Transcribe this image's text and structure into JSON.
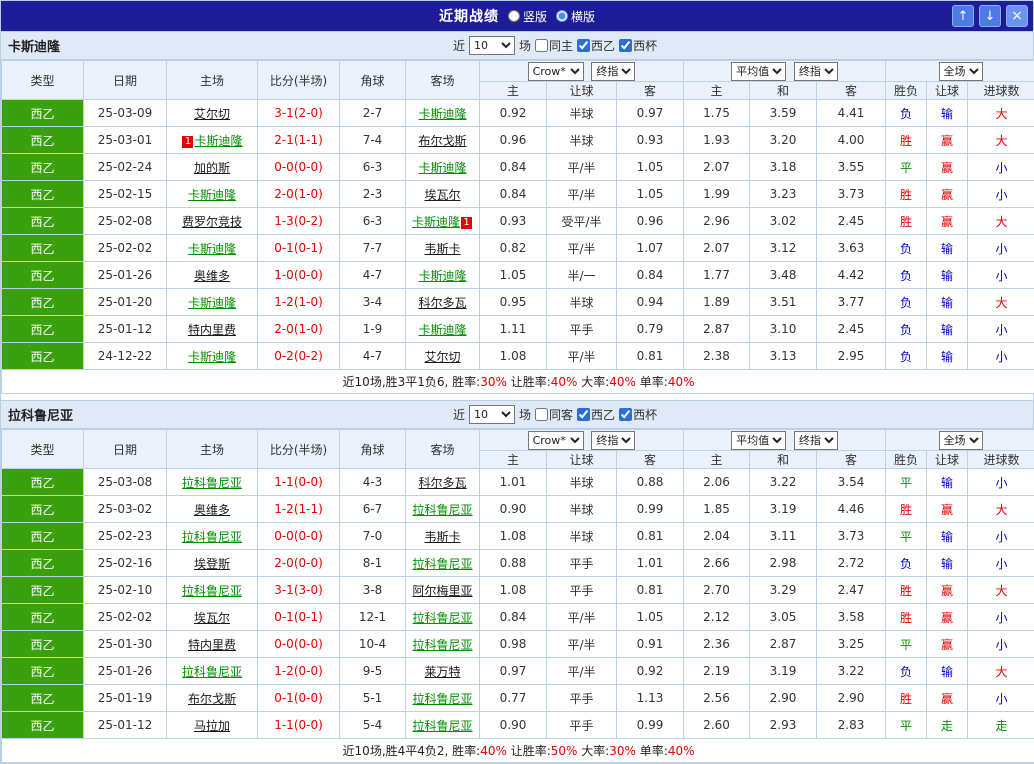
{
  "titlebar": {
    "title": "近期战绩",
    "radios": [
      {
        "label": "竖版",
        "selected": false
      },
      {
        "label": "横版",
        "selected": true
      }
    ],
    "up_button": "↑",
    "down_button": "↓",
    "close_button": "×"
  },
  "colors": {
    "titlebar_navy": "#1d1d99",
    "league_green": "#39a10c",
    "win_red": "#e60000",
    "loss_blue": "#0000cd",
    "draw_green": "#009100"
  },
  "columns": {
    "left": [
      "类型",
      "日期",
      "主场",
      "比分(半场)",
      "角球",
      "客场"
    ],
    "odds": [
      "主",
      "让球",
      "客"
    ],
    "avg": [
      "主",
      "和",
      "客"
    ],
    "result": [
      "胜负",
      "让球",
      "进球数"
    ]
  },
  "dropdowns": {
    "company": "Crow*",
    "final_index": "终指",
    "average": "平均值",
    "full_match": "全场"
  },
  "filter_labels": {
    "near": "近",
    "games": "场"
  },
  "sections": [
    {
      "team": "卡斯迪隆",
      "filter": {
        "count": "10",
        "same_venue": {
          "label": "同主",
          "checked": false
        },
        "league_a": {
          "label": "西乙",
          "checked": true
        },
        "league_b": {
          "label": "西杯",
          "checked": true
        }
      },
      "rows": [
        {
          "league": "西乙",
          "date": "25-03-09",
          "home": "艾尔切",
          "home_focus": false,
          "home_badge": "",
          "score": "3-1(2-0)",
          "corners": "2-7",
          "away": "卡斯迪隆",
          "away_focus": true,
          "away_badge": "",
          "odds": [
            "0.92",
            "半球",
            "0.97"
          ],
          "avg": [
            "1.75",
            "3.59",
            "4.41"
          ],
          "outcome": [
            "负",
            "输",
            "大"
          ]
        },
        {
          "league": "西乙",
          "date": "25-03-01",
          "home": "卡斯迪隆",
          "home_focus": true,
          "home_badge": "1",
          "score": "2-1(1-1)",
          "corners": "7-4",
          "away": "布尔戈斯",
          "away_focus": false,
          "away_badge": "",
          "odds": [
            "0.96",
            "半球",
            "0.93"
          ],
          "avg": [
            "1.93",
            "3.20",
            "4.00"
          ],
          "outcome": [
            "胜",
            "赢",
            "大"
          ]
        },
        {
          "league": "西乙",
          "date": "25-02-24",
          "home": "加的斯",
          "home_focus": false,
          "home_badge": "",
          "score": "0-0(0-0)",
          "corners": "6-3",
          "away": "卡斯迪隆",
          "away_focus": true,
          "away_badge": "",
          "odds": [
            "0.84",
            "平/半",
            "1.05"
          ],
          "avg": [
            "2.07",
            "3.18",
            "3.55"
          ],
          "outcome": [
            "平",
            "赢",
            "小"
          ]
        },
        {
          "league": "西乙",
          "date": "25-02-15",
          "home": "卡斯迪隆",
          "home_focus": true,
          "home_badge": "",
          "score": "2-0(1-0)",
          "corners": "2-3",
          "away": "埃瓦尔",
          "away_focus": false,
          "away_badge": "",
          "odds": [
            "0.84",
            "平/半",
            "1.05"
          ],
          "avg": [
            "1.99",
            "3.23",
            "3.73"
          ],
          "outcome": [
            "胜",
            "赢",
            "小"
          ]
        },
        {
          "league": "西乙",
          "date": "25-02-08",
          "home": "费罗尔竞技",
          "home_focus": false,
          "home_badge": "",
          "score": "1-3(0-2)",
          "corners": "6-3",
          "away": "卡斯迪隆",
          "away_focus": true,
          "away_badge": "1",
          "odds": [
            "0.93",
            "受平/半",
            "0.96"
          ],
          "avg": [
            "2.96",
            "3.02",
            "2.45"
          ],
          "outcome": [
            "胜",
            "赢",
            "大"
          ]
        },
        {
          "league": "西乙",
          "date": "25-02-02",
          "home": "卡斯迪隆",
          "home_focus": true,
          "home_badge": "",
          "score": "0-1(0-1)",
          "corners": "7-7",
          "away": "韦斯卡",
          "away_focus": false,
          "away_badge": "",
          "odds": [
            "0.82",
            "平/半",
            "1.07"
          ],
          "avg": [
            "2.07",
            "3.12",
            "3.63"
          ],
          "outcome": [
            "负",
            "输",
            "小"
          ]
        },
        {
          "league": "西乙",
          "date": "25-01-26",
          "home": "奥维多",
          "home_focus": false,
          "home_badge": "",
          "score": "1-0(0-0)",
          "corners": "4-7",
          "away": "卡斯迪隆",
          "away_focus": true,
          "away_badge": "",
          "odds": [
            "1.05",
            "半/一",
            "0.84"
          ],
          "avg": [
            "1.77",
            "3.48",
            "4.42"
          ],
          "outcome": [
            "负",
            "输",
            "小"
          ]
        },
        {
          "league": "西乙",
          "date": "25-01-20",
          "home": "卡斯迪隆",
          "home_focus": true,
          "home_badge": "",
          "score": "1-2(1-0)",
          "corners": "3-4",
          "away": "科尔多瓦",
          "away_focus": false,
          "away_badge": "",
          "odds": [
            "0.95",
            "半球",
            "0.94"
          ],
          "avg": [
            "1.89",
            "3.51",
            "3.77"
          ],
          "outcome": [
            "负",
            "输",
            "大"
          ]
        },
        {
          "league": "西乙",
          "date": "25-01-12",
          "home": "特内里费",
          "home_focus": false,
          "home_badge": "",
          "score": "2-0(1-0)",
          "corners": "1-9",
          "away": "卡斯迪隆",
          "away_focus": true,
          "away_badge": "",
          "odds": [
            "1.11",
            "平手",
            "0.79"
          ],
          "avg": [
            "2.87",
            "3.10",
            "2.45"
          ],
          "outcome": [
            "负",
            "输",
            "小"
          ]
        },
        {
          "league": "西乙",
          "date": "24-12-22",
          "home": "卡斯迪隆",
          "home_focus": true,
          "home_badge": "",
          "score": "0-2(0-2)",
          "corners": "4-7",
          "away": "艾尔切",
          "away_focus": false,
          "away_badge": "",
          "odds": [
            "1.08",
            "平/半",
            "0.81"
          ],
          "avg": [
            "2.38",
            "3.13",
            "2.95"
          ],
          "outcome": [
            "负",
            "输",
            "小"
          ]
        }
      ],
      "footer": {
        "prefix": "近10场,胜3平1负6, ",
        "stats": [
          {
            "label": "胜率:",
            "value": "30%"
          },
          {
            "label": " 让胜率:",
            "value": "40%"
          },
          {
            "label": " 大率:",
            "value": "40%"
          },
          {
            "label": " 单率:",
            "value": "40%"
          }
        ]
      }
    },
    {
      "team": "拉科鲁尼亚",
      "filter": {
        "count": "10",
        "same_venue": {
          "label": "同客",
          "checked": false
        },
        "league_a": {
          "label": "西乙",
          "checked": true
        },
        "league_b": {
          "label": "西杯",
          "checked": true
        }
      },
      "rows": [
        {
          "league": "西乙",
          "date": "25-03-08",
          "home": "拉科鲁尼亚",
          "home_focus": true,
          "home_badge": "",
          "score": "1-1(0-0)",
          "corners": "4-3",
          "away": "科尔多瓦",
          "away_focus": false,
          "away_badge": "",
          "odds": [
            "1.01",
            "半球",
            "0.88"
          ],
          "avg": [
            "2.06",
            "3.22",
            "3.54"
          ],
          "outcome": [
            "平",
            "输",
            "小"
          ]
        },
        {
          "league": "西乙",
          "date": "25-03-02",
          "home": "奥维多",
          "home_focus": false,
          "home_badge": "",
          "score": "1-2(1-1)",
          "corners": "6-7",
          "away": "拉科鲁尼亚",
          "away_focus": true,
          "away_badge": "",
          "odds": [
            "0.90",
            "半球",
            "0.99"
          ],
          "avg": [
            "1.85",
            "3.19",
            "4.46"
          ],
          "outcome": [
            "胜",
            "赢",
            "大"
          ]
        },
        {
          "league": "西乙",
          "date": "25-02-23",
          "home": "拉科鲁尼亚",
          "home_focus": true,
          "home_badge": "",
          "score": "0-0(0-0)",
          "corners": "7-0",
          "away": "韦斯卡",
          "away_focus": false,
          "away_badge": "",
          "odds": [
            "1.08",
            "半球",
            "0.81"
          ],
          "avg": [
            "2.04",
            "3.11",
            "3.73"
          ],
          "outcome": [
            "平",
            "输",
            "小"
          ]
        },
        {
          "league": "西乙",
          "date": "25-02-16",
          "home": "埃登斯",
          "home_focus": false,
          "home_badge": "",
          "score": "2-0(0-0)",
          "corners": "8-1",
          "away": "拉科鲁尼亚",
          "away_focus": true,
          "away_badge": "",
          "odds": [
            "0.88",
            "平手",
            "1.01"
          ],
          "avg": [
            "2.66",
            "2.98",
            "2.72"
          ],
          "outcome": [
            "负",
            "输",
            "小"
          ]
        },
        {
          "league": "西乙",
          "date": "25-02-10",
          "home": "拉科鲁尼亚",
          "home_focus": true,
          "home_badge": "",
          "score": "3-1(3-0)",
          "corners": "3-8",
          "away": "阿尔梅里亚",
          "away_focus": false,
          "away_badge": "",
          "odds": [
            "1.08",
            "平手",
            "0.81"
          ],
          "avg": [
            "2.70",
            "3.29",
            "2.47"
          ],
          "outcome": [
            "胜",
            "赢",
            "大"
          ]
        },
        {
          "league": "西乙",
          "date": "25-02-02",
          "home": "埃瓦尔",
          "home_focus": false,
          "home_badge": "",
          "score": "0-1(0-1)",
          "corners": "12-1",
          "away": "拉科鲁尼亚",
          "away_focus": true,
          "away_badge": "",
          "odds": [
            "0.84",
            "平/半",
            "1.05"
          ],
          "avg": [
            "2.12",
            "3.05",
            "3.58"
          ],
          "outcome": [
            "胜",
            "赢",
            "小"
          ]
        },
        {
          "league": "西乙",
          "date": "25-01-30",
          "home": "特内里费",
          "home_focus": false,
          "home_badge": "",
          "score": "0-0(0-0)",
          "corners": "10-4",
          "away": "拉科鲁尼亚",
          "away_focus": true,
          "away_badge": "",
          "odds": [
            "0.98",
            "平/半",
            "0.91"
          ],
          "avg": [
            "2.36",
            "2.87",
            "3.25"
          ],
          "outcome": [
            "平",
            "赢",
            "小"
          ]
        },
        {
          "league": "西乙",
          "date": "25-01-26",
          "home": "拉科鲁尼亚",
          "home_focus": true,
          "home_badge": "",
          "score": "1-2(0-0)",
          "corners": "9-5",
          "away": "莱万特",
          "away_focus": false,
          "away_badge": "",
          "odds": [
            "0.97",
            "平/半",
            "0.92"
          ],
          "avg": [
            "2.19",
            "3.19",
            "3.22"
          ],
          "outcome": [
            "负",
            "输",
            "大"
          ]
        },
        {
          "league": "西乙",
          "date": "25-01-19",
          "home": "布尔戈斯",
          "home_focus": false,
          "home_badge": "",
          "score": "0-1(0-0)",
          "corners": "5-1",
          "away": "拉科鲁尼亚",
          "away_focus": true,
          "away_badge": "",
          "odds": [
            "0.77",
            "平手",
            "1.13"
          ],
          "avg": [
            "2.56",
            "2.90",
            "2.90"
          ],
          "outcome": [
            "胜",
            "赢",
            "小"
          ]
        },
        {
          "league": "西乙",
          "date": "25-01-12",
          "home": "马拉加",
          "home_focus": false,
          "home_badge": "",
          "score": "1-1(0-0)",
          "corners": "5-4",
          "away": "拉科鲁尼亚",
          "away_focus": true,
          "away_badge": "",
          "odds": [
            "0.90",
            "平手",
            "0.99"
          ],
          "avg": [
            "2.60",
            "2.93",
            "2.83"
          ],
          "outcome": [
            "平",
            "走",
            "走"
          ]
        }
      ],
      "footer": {
        "prefix": "近10场,胜4平4负2, ",
        "stats": [
          {
            "label": "胜率:",
            "value": "40%"
          },
          {
            "label": " 让胜率:",
            "value": "50%"
          },
          {
            "label": " 大率:",
            "value": "30%"
          },
          {
            "label": " 单率:",
            "value": "40%"
          }
        ]
      }
    }
  ]
}
